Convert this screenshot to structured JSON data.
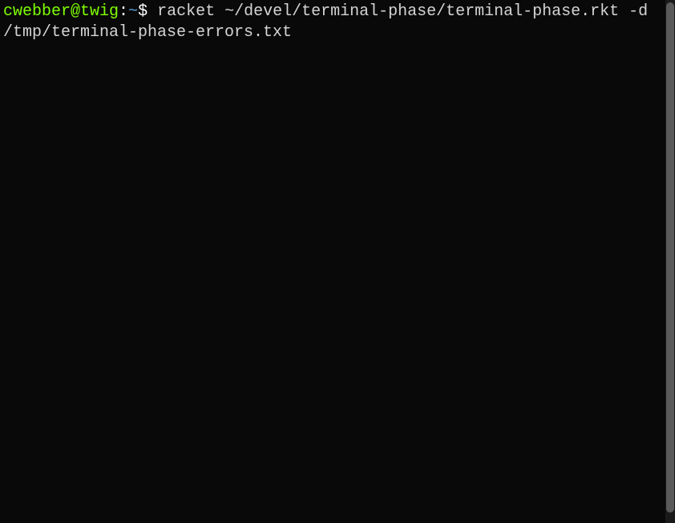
{
  "prompt": {
    "user_host": "cwebber@twig",
    "colon": ":",
    "path": "~",
    "dollar": "$",
    "command": " racket ~/devel/terminal-phase/terminal-phase.rkt -d /tmp/terminal-phase-errors.txt"
  }
}
